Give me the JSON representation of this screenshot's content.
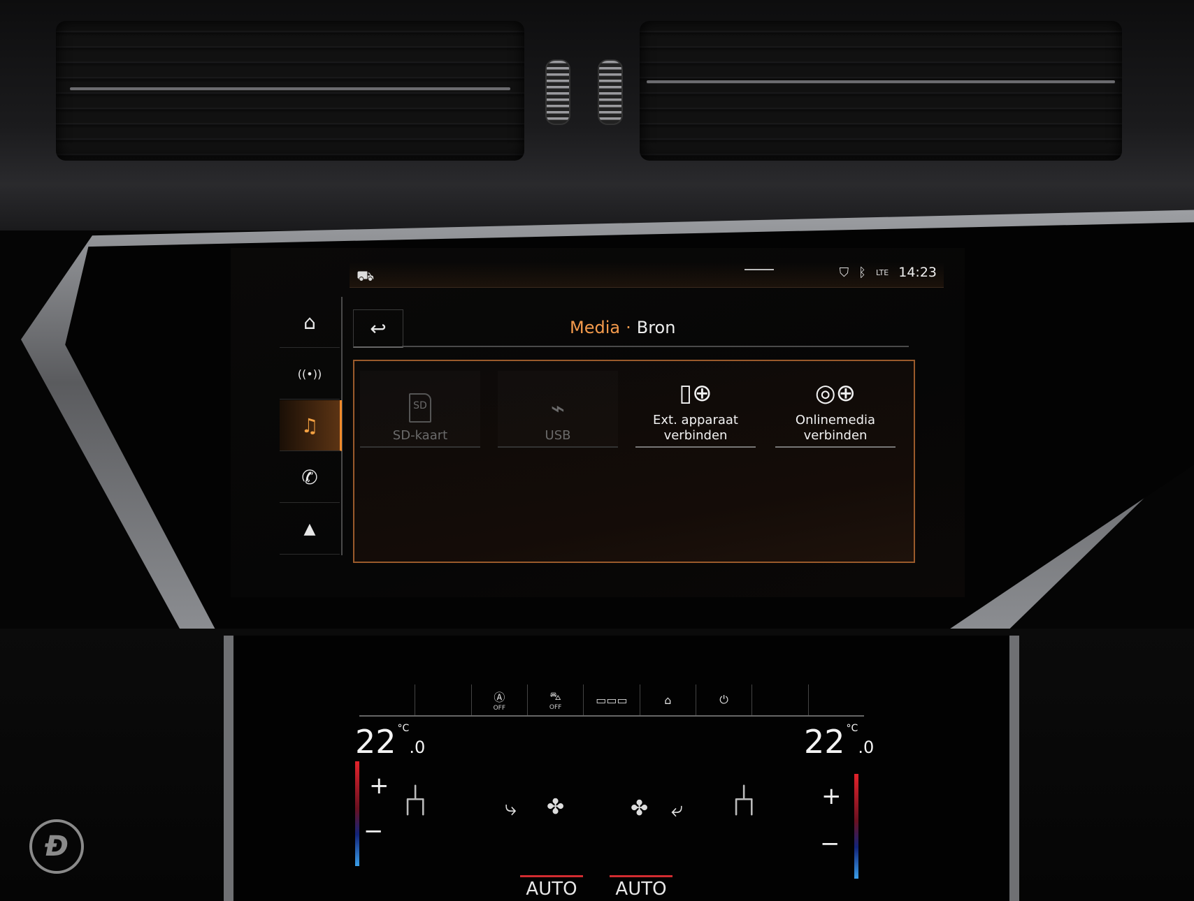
{
  "status_bar": {
    "time": "14:23",
    "icons": [
      "car-icon",
      "location-shield-icon",
      "bluetooth-icon",
      "lte-signal-icon"
    ]
  },
  "sidebar": {
    "items": [
      {
        "name": "home",
        "icon": "home-icon",
        "glyph": "⌂",
        "active": false
      },
      {
        "name": "radio",
        "icon": "radio-icon",
        "glyph": "((•))",
        "active": false
      },
      {
        "name": "media",
        "icon": "music-note-icon",
        "glyph": "♫",
        "active": true
      },
      {
        "name": "phone",
        "icon": "phone-icon",
        "glyph": "✆",
        "active": false
      },
      {
        "name": "navigation",
        "icon": "navigation-arrow-icon",
        "glyph": "▲",
        "active": false
      }
    ]
  },
  "header": {
    "back_glyph": "↩",
    "crumb_media": "Media",
    "crumb_separator": "·",
    "crumb_bron": "Bron"
  },
  "tiles": [
    {
      "label_line1": "SD-kaart",
      "label_line2": "",
      "icon": "sd-card-icon",
      "glyph": "SD",
      "enabled": false
    },
    {
      "label_line1": "USB",
      "label_line2": "",
      "icon": "usb-icon",
      "glyph": "⌁",
      "enabled": false
    },
    {
      "label_line1": "Ext. apparaat",
      "label_line2": "verbinden",
      "icon": "phone-add-icon",
      "glyph": "▯⊕",
      "enabled": true
    },
    {
      "label_line1": "Onlinemedia",
      "label_line2": "verbinden",
      "icon": "online-media-add-icon",
      "glyph": "◎⊕",
      "enabled": true
    }
  ],
  "climate": {
    "temp_left": "22",
    "temp_left_decimal": ".0",
    "temp_right": "22",
    "temp_right_decimal": ".0",
    "unit": "°C",
    "plus": "+",
    "minus": "−",
    "auto_left": "AUTO",
    "auto_right": "AUTO",
    "off_label": "OFF",
    "buttons": [
      "auto-off-icon",
      "recirculation-off-icon",
      "rear-defrost-icon",
      "rear-climate-icon",
      "power-icon"
    ]
  },
  "colors": {
    "accent": "#F49A4C",
    "panel_border": "#9A5A2B",
    "temp_hot": "#E3232B",
    "temp_cold": "#3A9EE8"
  }
}
